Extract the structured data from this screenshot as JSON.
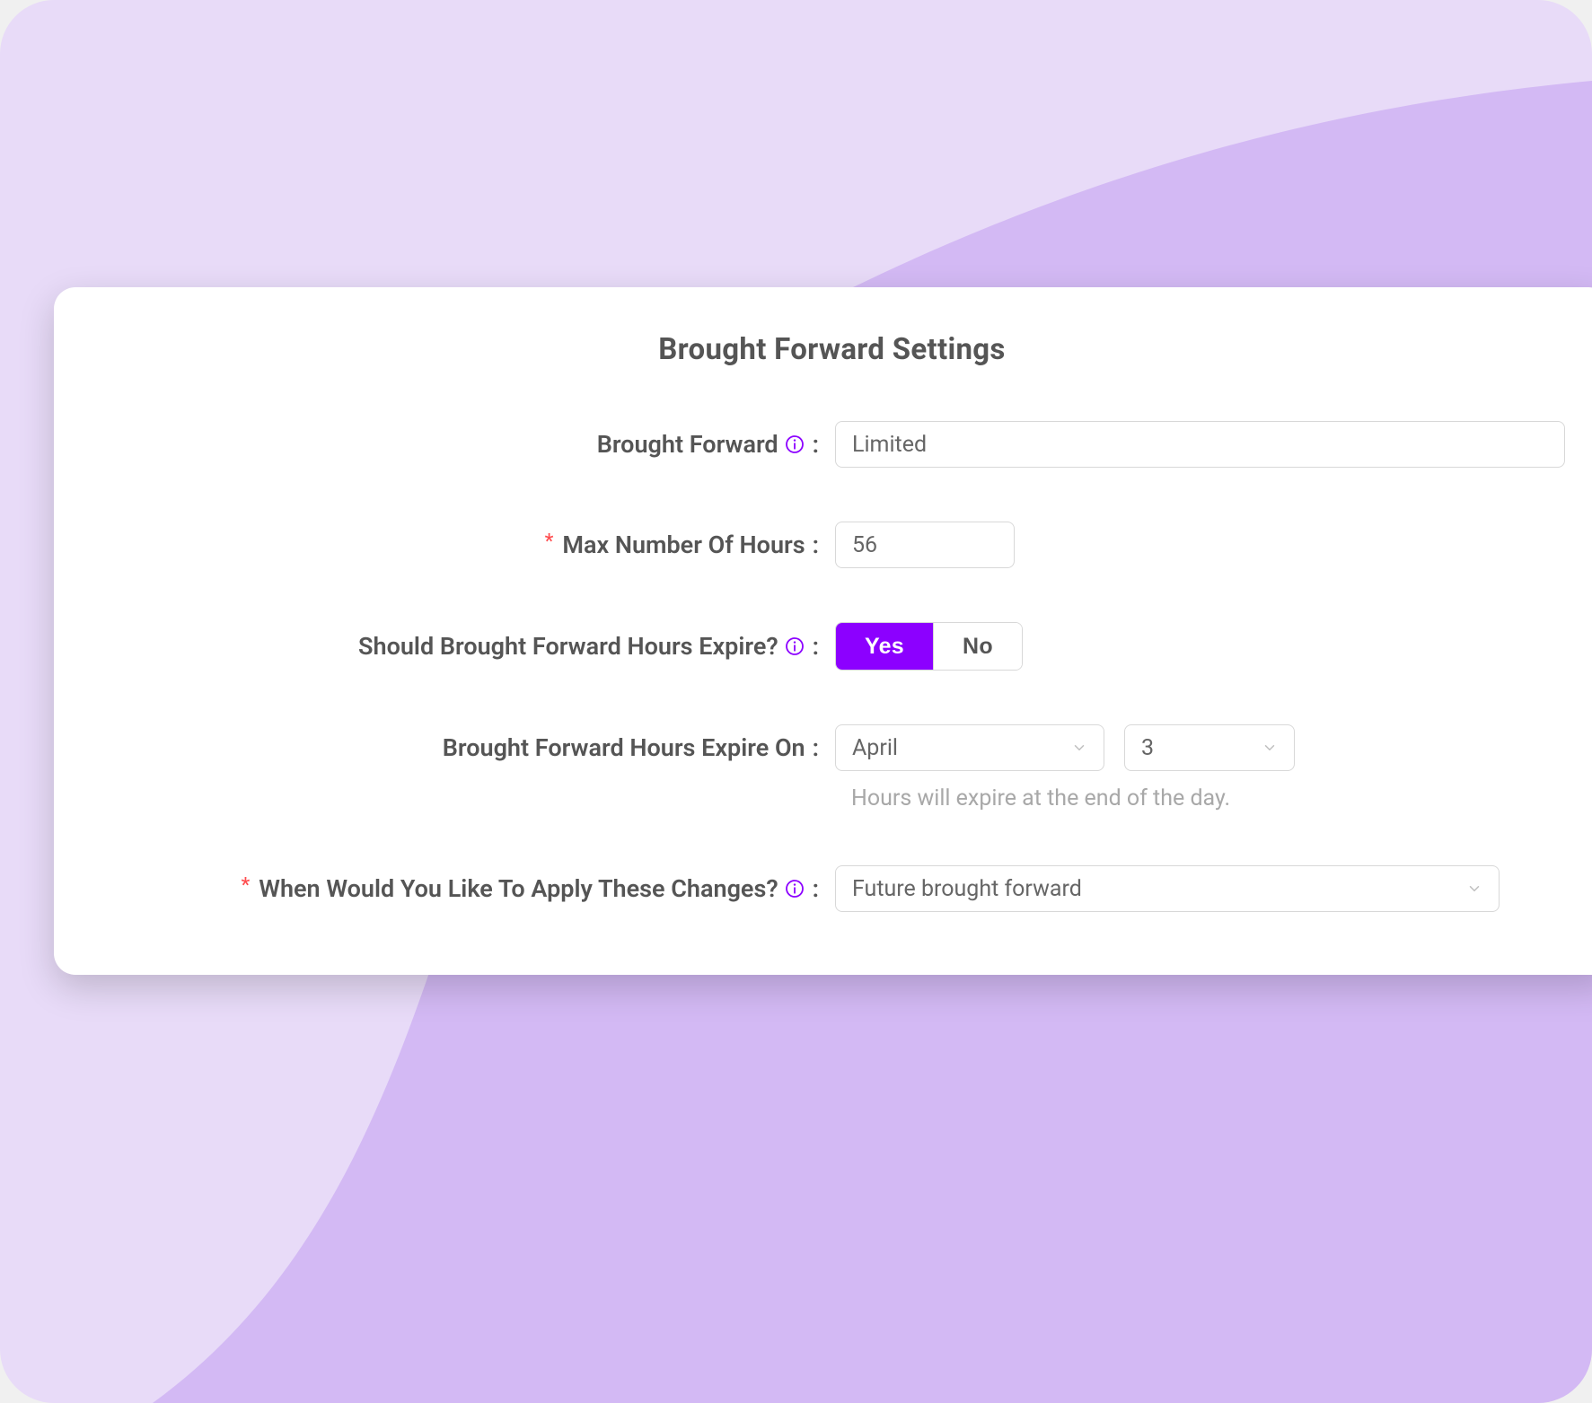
{
  "colors": {
    "bg_light": "#e8dbf8",
    "bg_wave": "#d3b9f4",
    "accent": "#8c00ff",
    "info_stroke": "#8c00ff",
    "required": "#ff4d4f"
  },
  "panel": {
    "title": "Brought Forward Settings",
    "fields": {
      "brought_forward": {
        "label": "Brought Forward",
        "has_info": true,
        "value": "Limited"
      },
      "max_hours": {
        "required": true,
        "label": "Max Number Of Hours",
        "value": "56"
      },
      "expire": {
        "label": "Should Brought Forward Hours Expire?",
        "has_info": true,
        "yes": "Yes",
        "no": "No",
        "selected": "yes"
      },
      "expire_on": {
        "label": "Brought Forward Hours Expire On",
        "month": "April",
        "day": "3",
        "hint": "Hours will expire at the end of the day."
      },
      "apply_when": {
        "required": true,
        "label": "When Would You Like To Apply These Changes?",
        "has_info": true,
        "value": "Future brought forward"
      }
    }
  }
}
